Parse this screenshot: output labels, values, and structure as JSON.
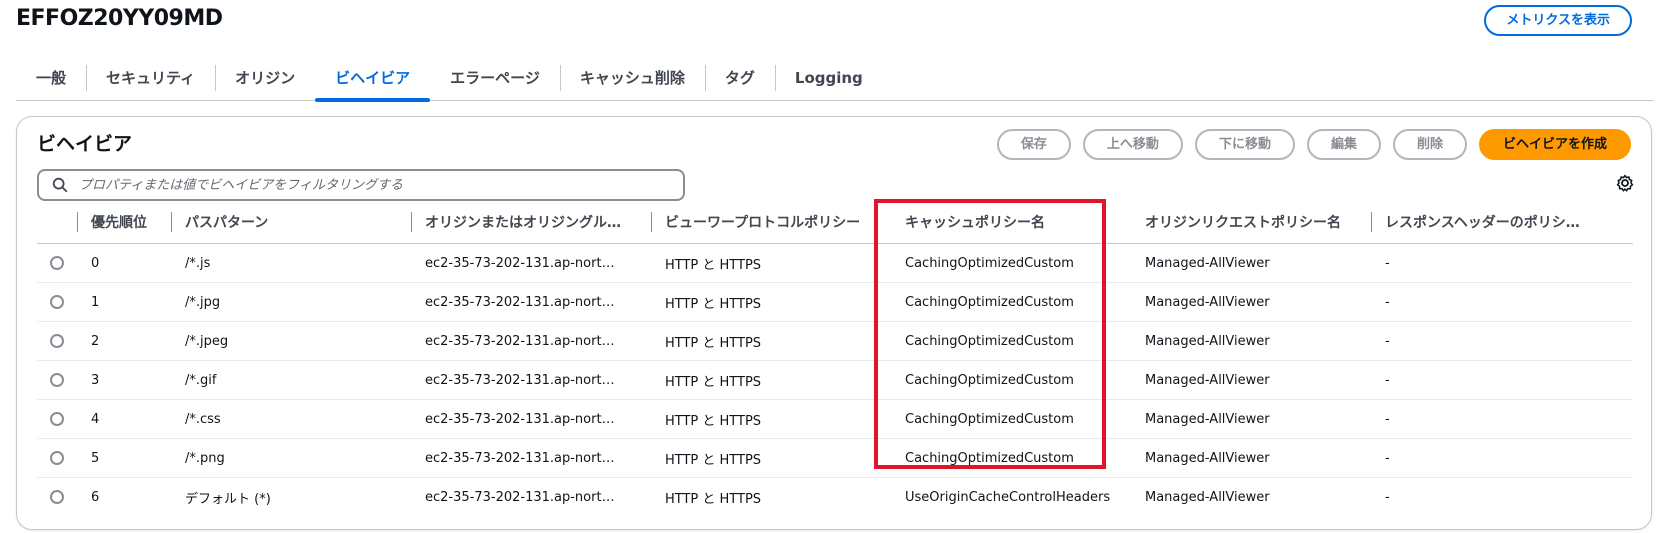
{
  "page": {
    "title": "EFFOZ20YY09MD",
    "metrics_button": "メトリクスを表示"
  },
  "tabs": [
    {
      "label": "一般",
      "active": false
    },
    {
      "label": "セキュリティ",
      "active": false
    },
    {
      "label": "オリジン",
      "active": false
    },
    {
      "label": "ビヘイビア",
      "active": true
    },
    {
      "label": "エラーページ",
      "active": false
    },
    {
      "label": "キャッシュ削除",
      "active": false
    },
    {
      "label": "タグ",
      "active": false
    },
    {
      "label": "Logging",
      "active": false
    }
  ],
  "behaviors": {
    "title": "ビヘイビア",
    "actions": {
      "save": "保存",
      "move_up": "上へ移動",
      "move_down": "下に移動",
      "edit": "編集",
      "delete": "削除",
      "create": "ビヘイビアを作成"
    },
    "search_placeholder": "プロパティまたは値でビヘイビアをフィルタリングする",
    "columns": [
      "優先順位",
      "パスパターン",
      "オリジンまたはオリジングル…",
      "ビューワープロトコルポリシー",
      "キャッシュポリシー名",
      "オリジンリクエストポリシー名",
      "レスポンスヘッダーのポリシ…"
    ],
    "rows": [
      {
        "priority": "0",
        "path": "/*.js",
        "origin": "ec2-35-73-202-131.ap-nort…",
        "protocol": "HTTP と HTTPS",
        "cache_policy": "CachingOptimizedCustom",
        "origin_request": "Managed-AllViewer",
        "response_headers": "-"
      },
      {
        "priority": "1",
        "path": "/*.jpg",
        "origin": "ec2-35-73-202-131.ap-nort…",
        "protocol": "HTTP と HTTPS",
        "cache_policy": "CachingOptimizedCustom",
        "origin_request": "Managed-AllViewer",
        "response_headers": "-"
      },
      {
        "priority": "2",
        "path": "/*.jpeg",
        "origin": "ec2-35-73-202-131.ap-nort…",
        "protocol": "HTTP と HTTPS",
        "cache_policy": "CachingOptimizedCustom",
        "origin_request": "Managed-AllViewer",
        "response_headers": "-"
      },
      {
        "priority": "3",
        "path": "/*.gif",
        "origin": "ec2-35-73-202-131.ap-nort…",
        "protocol": "HTTP と HTTPS",
        "cache_policy": "CachingOptimizedCustom",
        "origin_request": "Managed-AllViewer",
        "response_headers": "-"
      },
      {
        "priority": "4",
        "path": "/*.css",
        "origin": "ec2-35-73-202-131.ap-nort…",
        "protocol": "HTTP と HTTPS",
        "cache_policy": "CachingOptimizedCustom",
        "origin_request": "Managed-AllViewer",
        "response_headers": "-"
      },
      {
        "priority": "5",
        "path": "/*.png",
        "origin": "ec2-35-73-202-131.ap-nort…",
        "protocol": "HTTP と HTTPS",
        "cache_policy": "CachingOptimizedCustom",
        "origin_request": "Managed-AllViewer",
        "response_headers": "-"
      },
      {
        "priority": "6",
        "path": "デフォルト (*)",
        "origin": "ec2-35-73-202-131.ap-nort…",
        "protocol": "HTTP と HTTPS",
        "cache_policy": "UseOriginCacheControlHeaders",
        "origin_request": "Managed-AllViewer",
        "response_headers": "-"
      }
    ]
  },
  "colors": {
    "accent": "#006ce0",
    "primary_button": "#ff9900",
    "highlight_box": "#e0142a"
  },
  "icons": [
    "search-icon",
    "settings-gear-icon"
  ]
}
